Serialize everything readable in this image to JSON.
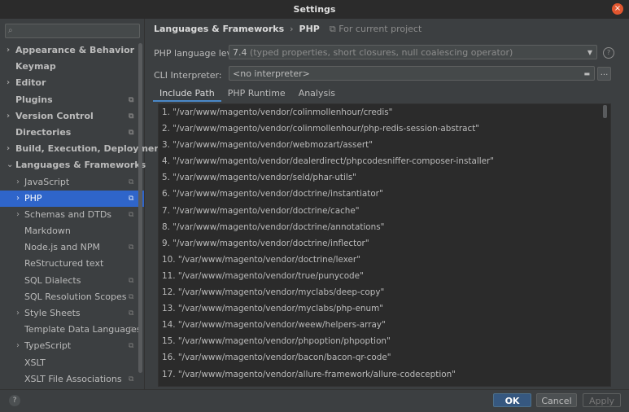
{
  "window": {
    "title": "Settings",
    "close_icon": "×"
  },
  "sidebar": {
    "search_placeholder": "",
    "search_icon": "⌕",
    "items": [
      {
        "label": "Appearance & Behavior",
        "level": 1,
        "expandable": true
      },
      {
        "label": "Keymap",
        "level": 1,
        "expandable": false
      },
      {
        "label": "Editor",
        "level": 1,
        "expandable": true
      },
      {
        "label": "Plugins",
        "level": 1,
        "expandable": false,
        "project": true
      },
      {
        "label": "Version Control",
        "level": 1,
        "expandable": true,
        "project": true
      },
      {
        "label": "Directories",
        "level": 1,
        "expandable": false,
        "project": true
      },
      {
        "label": "Build, Execution, Deployment",
        "level": 1,
        "expandable": true
      },
      {
        "label": "Languages & Frameworks",
        "level": 1,
        "expanded": true
      },
      {
        "label": "JavaScript",
        "level": 2,
        "expandable": true,
        "project": true
      },
      {
        "label": "PHP",
        "level": 2,
        "expandable": true,
        "project": true,
        "selected": true
      },
      {
        "label": "Schemas and DTDs",
        "level": 2,
        "expandable": true,
        "project": true
      },
      {
        "label": "Markdown",
        "level": 2,
        "expandable": false
      },
      {
        "label": "Node.js and NPM",
        "level": 2,
        "expandable": false,
        "project": true
      },
      {
        "label": "ReStructured text",
        "level": 2,
        "expandable": false
      },
      {
        "label": "SQL Dialects",
        "level": 2,
        "expandable": false,
        "project": true
      },
      {
        "label": "SQL Resolution Scopes",
        "level": 2,
        "expandable": false,
        "project": true
      },
      {
        "label": "Style Sheets",
        "level": 2,
        "expandable": true,
        "project": true
      },
      {
        "label": "Template Data Languages",
        "level": 2,
        "expandable": false,
        "project": true
      },
      {
        "label": "TypeScript",
        "level": 2,
        "expandable": true,
        "project": true
      },
      {
        "label": "XSLT",
        "level": 2,
        "expandable": false
      },
      {
        "label": "XSLT File Associations",
        "level": 2,
        "expandable": false,
        "project": true
      }
    ]
  },
  "breadcrumb": {
    "parent": "Languages & Frameworks",
    "separator": "›",
    "current": "PHP",
    "scope_icon": "⧉",
    "scope": "For current project"
  },
  "php_level": {
    "label": "PHP language level:",
    "value": "7.4",
    "detail": "(typed properties, short closures, null coalescing operator)"
  },
  "cli": {
    "label": "CLI Interpreter:",
    "value": "<no interpreter>",
    "browse": "..."
  },
  "tabs": [
    "Include Path",
    "PHP Runtime",
    "Analysis"
  ],
  "include_paths": [
    "1. \"/var/www/magento/vendor/colinmollenhour/credis\"",
    "2. \"/var/www/magento/vendor/colinmollenhour/php-redis-session-abstract\"",
    "3. \"/var/www/magento/vendor/webmozart/assert\"",
    "4. \"/var/www/magento/vendor/dealerdirect/phpcodesniffer-composer-installer\"",
    "5. \"/var/www/magento/vendor/seld/phar-utils\"",
    "6. \"/var/www/magento/vendor/doctrine/instantiator\"",
    "7. \"/var/www/magento/vendor/doctrine/cache\"",
    "8. \"/var/www/magento/vendor/doctrine/annotations\"",
    "9. \"/var/www/magento/vendor/doctrine/inflector\"",
    "10. \"/var/www/magento/vendor/doctrine/lexer\"",
    "11. \"/var/www/magento/vendor/true/punycode\"",
    "12. \"/var/www/magento/vendor/myclabs/deep-copy\"",
    "13. \"/var/www/magento/vendor/myclabs/php-enum\"",
    "14. \"/var/www/magento/vendor/weew/helpers-array\"",
    "15. \"/var/www/magento/vendor/phpoption/phpoption\"",
    "16. \"/var/www/magento/vendor/bacon/bacon-qr-code\"",
    "17. \"/var/www/magento/vendor/allure-framework/allure-codeception\""
  ],
  "footer": {
    "help": "?",
    "ok": "OK",
    "cancel": "Cancel",
    "apply": "Apply"
  },
  "colors": {
    "selection": "#2f65ca",
    "primary_button": "#365880",
    "close": "#e2562f"
  }
}
